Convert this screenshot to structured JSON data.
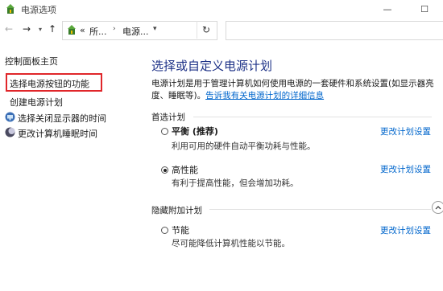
{
  "window": {
    "title": "电源选项",
    "minimize": "—",
    "maximize": "☐"
  },
  "nav": {
    "back": "←",
    "forward": "→",
    "up": "↑",
    "refresh": "↻"
  },
  "address": {
    "crumb1": "所...",
    "crumb2": "电源...",
    "prefix": "«",
    "sep": "›",
    "dropdown": "▾"
  },
  "sidebar": {
    "home": "控制面板主页",
    "items": [
      {
        "label": "选择电源按钮的功能"
      },
      {
        "label": "创建电源计划"
      },
      {
        "label": "选择关闭显示器的时间"
      },
      {
        "label": "更改计算机睡眠时间"
      }
    ]
  },
  "main": {
    "title": "选择或自定义电源计划",
    "description": "电源计划是用于管理计算机如何使用电源的一套硬件和系统设置(如显示器亮度、睡眠等)。",
    "description_link": "告诉我有关电源计划的详细信息",
    "preferred_label": "首选计划",
    "hidden_label": "隐藏附加计划",
    "change_label": "更改计划设置",
    "plans": [
      {
        "name": "平衡 (推荐)",
        "desc": "利用可用的硬件自动平衡功耗与性能。",
        "checked": false
      },
      {
        "name": "高性能",
        "desc": "有利于提高性能，但会增加功耗。",
        "checked": true
      },
      {
        "name": "节能",
        "desc": "尽可能降低计算机性能以节能。",
        "checked": false
      }
    ]
  },
  "colors": {
    "title": "#1e3287",
    "link": "#0066cc",
    "highlight": "#e0262a"
  }
}
